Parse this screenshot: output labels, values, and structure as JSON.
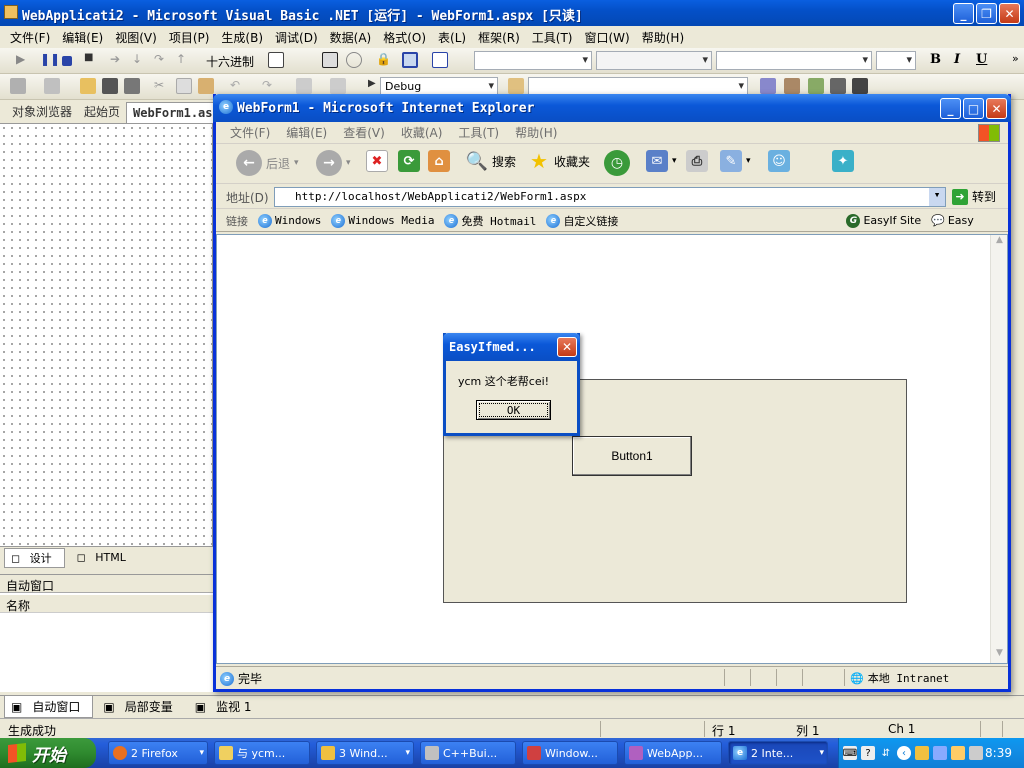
{
  "vs": {
    "title": "WebApplicati2 - Microsoft Visual Basic .NET [运行] - WebForm1.aspx  [只读]",
    "menu": [
      "文件(F)",
      "编辑(E)",
      "视图(V)",
      "项目(P)",
      "生成(B)",
      "调试(D)",
      "数据(A)",
      "格式(O)",
      "表(L)",
      "框架(R)",
      "工具(T)",
      "窗口(W)",
      "帮助(H)"
    ],
    "hex_label": "十六进制",
    "config": "Debug",
    "bold": "B",
    "italic": "I",
    "underline": "U",
    "tabs": [
      "对象浏览器",
      "起始页",
      "WebForm1.asp"
    ],
    "view_tabs": [
      "设计",
      "HTML"
    ],
    "auto_window_title": "自动窗口",
    "name_col": "名称",
    "bottom_tabs": [
      "自动窗口",
      "局部变量",
      "监视 1"
    ],
    "status": {
      "message": "生成成功",
      "row": "行 1",
      "col": "列 1",
      "ch": "Ch 1"
    }
  },
  "ie": {
    "title": "WebForm1 - Microsoft Internet Explorer",
    "menu": [
      "文件(F)",
      "编辑(E)",
      "查看(V)",
      "收藏(A)",
      "工具(T)",
      "帮助(H)"
    ],
    "back": "后退",
    "search": "搜索",
    "favorites": "收藏夹",
    "address_label": "地址(D)",
    "url": "http://localhost/WebApplicati2/WebForm1.aspx",
    "go": "转到",
    "links_label": "链接",
    "links": [
      "Windows",
      "Windows Media",
      "免费 Hotmail",
      "自定义链接"
    ],
    "easy_site": "EasyIf Site",
    "easy": "Easy",
    "button1": "Button1",
    "status_done": "完毕",
    "zone": "本地 Intranet"
  },
  "alert": {
    "title": "EasyIfmed...",
    "message": "ycm 这个老帮cei!",
    "ok": "OK"
  },
  "taskbar": {
    "start": "开始",
    "tasks": [
      "2 Firefox",
      "与 ycm...",
      "3 Wind...",
      "C++Bui...",
      "Window...",
      "WebApp...",
      "2 Inte..."
    ],
    "clock": "8:39"
  }
}
